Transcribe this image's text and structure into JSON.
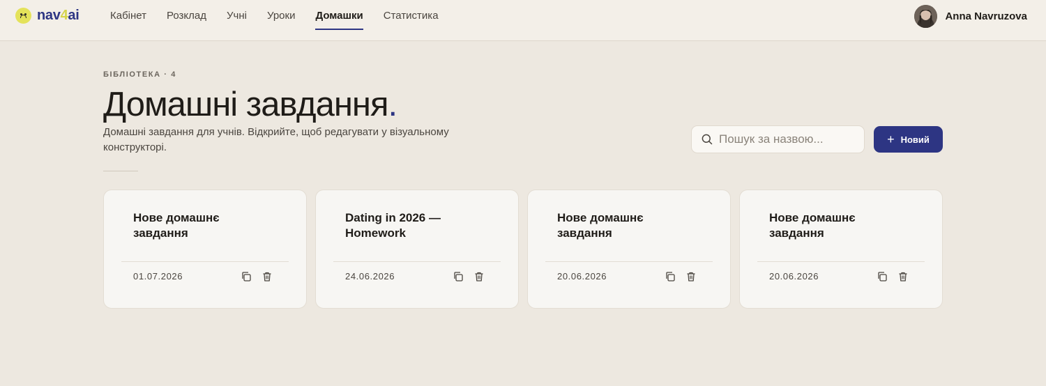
{
  "brand": {
    "name_prefix": "nav",
    "name_four": "4",
    "name_suffix": "ai"
  },
  "nav": {
    "items": [
      {
        "label": "Кабінет"
      },
      {
        "label": "Розклад"
      },
      {
        "label": "Учні"
      },
      {
        "label": "Уроки"
      },
      {
        "label": "Домашки",
        "active": true
      },
      {
        "label": "Статистика"
      }
    ]
  },
  "user": {
    "name": "Anna Navruzova"
  },
  "header": {
    "eyebrow": "БІБЛІОТЕКА · 4",
    "title": "Домашні завдання",
    "title_dot": ".",
    "subtitle": "Домашні завдання для учнів. Відкрийте, щоб редагувати у візуальному конструкторі."
  },
  "search": {
    "placeholder": "Пошук за назвою...",
    "value": ""
  },
  "new_button": {
    "label": "Новий"
  },
  "cards": [
    {
      "title": "Нове домашнє завдання",
      "date": "01.07.2026"
    },
    {
      "title": "Dating in 2026 — Homework",
      "date": "24.06.2026"
    },
    {
      "title": "Нове домашнє завдання",
      "date": "20.06.2026"
    },
    {
      "title": "Нове домашнє завдання",
      "date": "20.06.2026"
    }
  ],
  "colors": {
    "accent": "#2d3583",
    "background": "#ede8e0",
    "logo_yellow": "#e4e25a"
  }
}
